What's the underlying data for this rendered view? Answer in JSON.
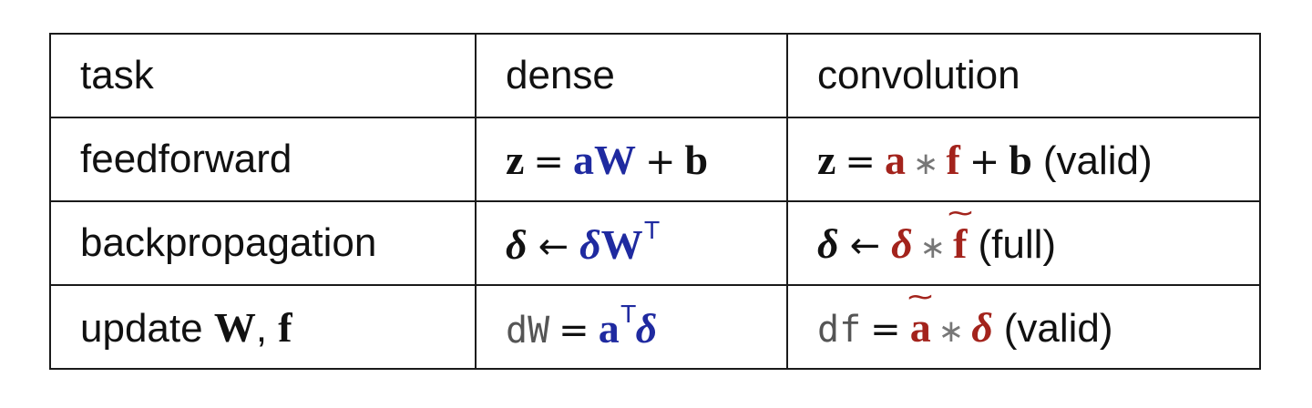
{
  "headers": {
    "task": "task",
    "dense": "dense",
    "convolution": "convolution"
  },
  "rows": [
    {
      "task_text": "feedforward",
      "dense": {
        "lhs": "z",
        "eq": "=",
        "a": "a",
        "W": "W",
        "plus": "+",
        "b": "b"
      },
      "conv": {
        "lhs": "z",
        "eq": "=",
        "a": "a",
        "star": "∗",
        "f": "f",
        "plus": "+",
        "b": "b",
        "note": "(valid)"
      }
    },
    {
      "task_text": "backpropagation",
      "dense": {
        "lhs": "δ",
        "arrow": "←",
        "delta": "δ",
        "W": "W",
        "sup": "T"
      },
      "conv": {
        "lhs": "δ",
        "arrow": "←",
        "delta": "δ",
        "star": "∗",
        "f": "f",
        "note": "(full)"
      }
    },
    {
      "task_prefix": "update",
      "task_W": "W",
      "task_comma": ",",
      "task_f": "f",
      "dense": {
        "lhs": "dW",
        "eq": "=",
        "a": "a",
        "sup": "T",
        "delta": "δ"
      },
      "conv": {
        "lhs": "df",
        "eq": "=",
        "a": "a",
        "star": "∗",
        "delta": "δ",
        "note": "(valid)"
      }
    }
  ],
  "colors": {
    "blue": "#1f2aa0",
    "red": "#a3231c",
    "text": "#111111",
    "border": "#1a1a1a"
  }
}
